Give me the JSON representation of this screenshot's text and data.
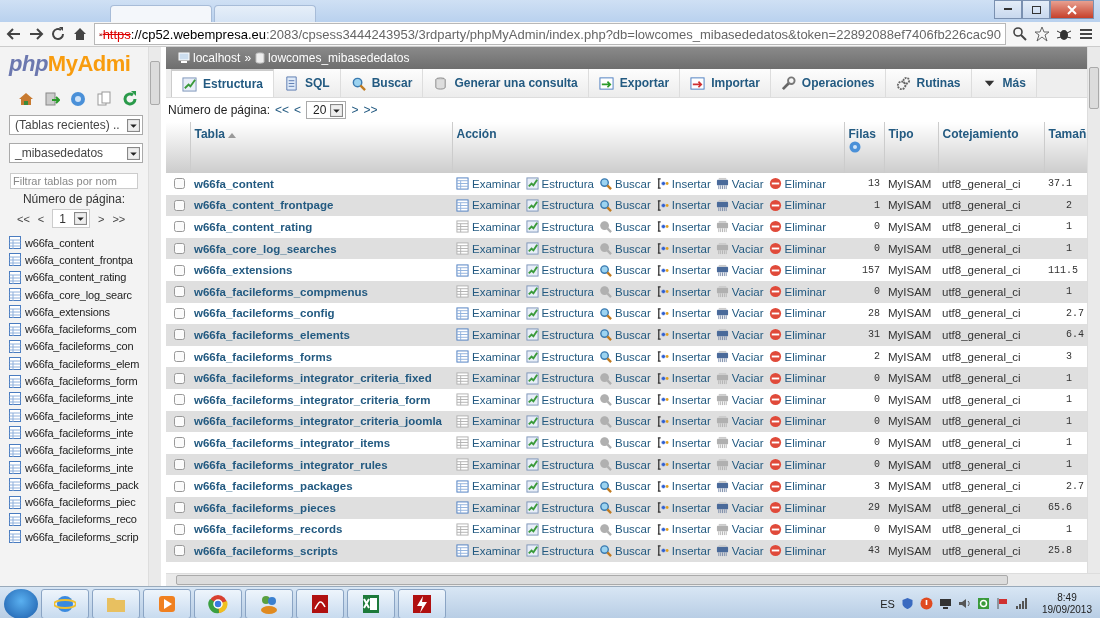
{
  "browser": {
    "url": {
      "scheme": "https",
      "host": "://cp52.webempresa.eu",
      "path": ":2083/cpsess3444243953/3rdparty/phpMyAdmin/index.php?db=lowcomes_mibasededatos&token=22892088ef7406fb226cac90"
    }
  },
  "sidebar": {
    "logo": {
      "php": "php",
      "rest": "MyAdmi"
    },
    "recent_select": "(Tablas recientes) ..",
    "db_select": "_mibasededatos",
    "filter": {
      "placeholder": "Filtrar tablas por nom"
    },
    "page_label": "Número de página:",
    "pager": {
      "first": "<<",
      "prev": "<",
      "page": "1",
      "next": ">",
      "last": ">>"
    },
    "tables": [
      "w66fa_content",
      "w66fa_content_frontpa",
      "w66fa_content_rating",
      "w66fa_core_log_searc",
      "w66fa_extensions",
      "w66fa_facileforms_com",
      "w66fa_facileforms_con",
      "w66fa_facileforms_elem",
      "w66fa_facileforms_form",
      "w66fa_facileforms_inte",
      "w66fa_facileforms_inte",
      "w66fa_facileforms_inte",
      "w66fa_facileforms_inte",
      "w66fa_facileforms_inte",
      "w66fa_facileforms_pack",
      "w66fa_facileforms_piec",
      "w66fa_facileforms_reco",
      "w66fa_facileforms_scrip"
    ]
  },
  "breadcrumb": {
    "server": "localhost",
    "separator": "»",
    "database": "lowcomes_mibasededatos"
  },
  "tabs": [
    {
      "kind": "structure",
      "label": "Estructura",
      "selected": true
    },
    {
      "kind": "sql",
      "label": "SQL",
      "selected": false
    },
    {
      "kind": "search",
      "label": "Buscar",
      "selected": false
    },
    {
      "kind": "query",
      "label": "Generar una consulta",
      "selected": false
    },
    {
      "kind": "export",
      "label": "Exportar",
      "selected": false
    },
    {
      "kind": "import",
      "label": "Importar",
      "selected": false
    },
    {
      "kind": "operations",
      "label": "Operaciones",
      "selected": false
    },
    {
      "kind": "routines",
      "label": "Rutinas",
      "selected": false
    },
    {
      "kind": "more",
      "label": "Más",
      "selected": false
    }
  ],
  "pagination": {
    "label": "Número de página:",
    "first": "<<",
    "prev": "<",
    "value": "20",
    "next": ">",
    "last": ">>"
  },
  "table": {
    "columns": [
      "Tabla",
      "Acción",
      "Filas",
      "Tipo",
      "Cotejamiento",
      "Tamañ"
    ],
    "rows": [
      {
        "name": "w66fa_content",
        "checked": false,
        "empty": false,
        "actions": [
          "Examinar",
          "Estructura",
          "Buscar",
          "Insertar",
          "Vaciar",
          "Eliminar"
        ],
        "rows": "13",
        "type": "MyISAM",
        "collation": "utf8_general_ci",
        "size": "37.1"
      },
      {
        "name": "w66fa_content_frontpage",
        "checked": false,
        "empty": false,
        "actions": [
          "Examinar",
          "Estructura",
          "Buscar",
          "Insertar",
          "Vaciar",
          "Eliminar"
        ],
        "rows": "1",
        "type": "MyISAM",
        "collation": "utf8_general_ci",
        "size": "2"
      },
      {
        "name": "w66fa_content_rating",
        "checked": false,
        "empty": true,
        "actions": [
          "Examinar",
          "Estructura",
          "Buscar",
          "Insertar",
          "Vaciar",
          "Eliminar"
        ],
        "rows": "0",
        "type": "MyISAM",
        "collation": "utf8_general_ci",
        "size": "1"
      },
      {
        "name": "w66fa_core_log_searches",
        "checked": false,
        "empty": true,
        "actions": [
          "Examinar",
          "Estructura",
          "Buscar",
          "Insertar",
          "Vaciar",
          "Eliminar"
        ],
        "rows": "0",
        "type": "MyISAM",
        "collation": "utf8_general_ci",
        "size": "1"
      },
      {
        "name": "w66fa_extensions",
        "checked": false,
        "empty": false,
        "actions": [
          "Examinar",
          "Estructura",
          "Buscar",
          "Insertar",
          "Vaciar",
          "Eliminar"
        ],
        "rows": "157",
        "type": "MyISAM",
        "collation": "utf8_general_ci",
        "size": "111.5"
      },
      {
        "name": "w66fa_facileforms_compmenus",
        "checked": false,
        "empty": true,
        "actions": [
          "Examinar",
          "Estructura",
          "Buscar",
          "Insertar",
          "Vaciar",
          "Eliminar"
        ],
        "rows": "0",
        "type": "MyISAM",
        "collation": "utf8_general_ci",
        "size": "1"
      },
      {
        "name": "w66fa_facileforms_config",
        "checked": false,
        "empty": false,
        "actions": [
          "Examinar",
          "Estructura",
          "Buscar",
          "Insertar",
          "Vaciar",
          "Eliminar"
        ],
        "rows": "28",
        "type": "MyISAM",
        "collation": "utf8_general_ci",
        "size": "2.7"
      },
      {
        "name": "w66fa_facileforms_elements",
        "checked": false,
        "empty": false,
        "actions": [
          "Examinar",
          "Estructura",
          "Buscar",
          "Insertar",
          "Vaciar",
          "Eliminar"
        ],
        "rows": "31",
        "type": "MyISAM",
        "collation": "utf8_general_ci",
        "size": "6.4"
      },
      {
        "name": "w66fa_facileforms_forms",
        "checked": false,
        "empty": false,
        "actions": [
          "Examinar",
          "Estructura",
          "Buscar",
          "Insertar",
          "Vaciar",
          "Eliminar"
        ],
        "rows": "2",
        "type": "MyISAM",
        "collation": "utf8_general_ci",
        "size": "3"
      },
      {
        "name": "w66fa_facileforms_integrator_criteria_fixed",
        "checked": false,
        "empty": true,
        "actions": [
          "Examinar",
          "Estructura",
          "Buscar",
          "Insertar",
          "Vaciar",
          "Eliminar"
        ],
        "rows": "0",
        "type": "MyISAM",
        "collation": "utf8_general_ci",
        "size": "1"
      },
      {
        "name": "w66fa_facileforms_integrator_criteria_form",
        "checked": false,
        "empty": true,
        "actions": [
          "Examinar",
          "Estructura",
          "Buscar",
          "Insertar",
          "Vaciar",
          "Eliminar"
        ],
        "rows": "0",
        "type": "MyISAM",
        "collation": "utf8_general_ci",
        "size": "1"
      },
      {
        "name": "w66fa_facileforms_integrator_criteria_joomla",
        "checked": false,
        "empty": true,
        "actions": [
          "Examinar",
          "Estructura",
          "Buscar",
          "Insertar",
          "Vaciar",
          "Eliminar"
        ],
        "rows": "0",
        "type": "MyISAM",
        "collation": "utf8_general_ci",
        "size": "1"
      },
      {
        "name": "w66fa_facileforms_integrator_items",
        "checked": false,
        "empty": true,
        "actions": [
          "Examinar",
          "Estructura",
          "Buscar",
          "Insertar",
          "Vaciar",
          "Eliminar"
        ],
        "rows": "0",
        "type": "MyISAM",
        "collation": "utf8_general_ci",
        "size": "1"
      },
      {
        "name": "w66fa_facileforms_integrator_rules",
        "checked": false,
        "empty": true,
        "actions": [
          "Examinar",
          "Estructura",
          "Buscar",
          "Insertar",
          "Vaciar",
          "Eliminar"
        ],
        "rows": "0",
        "type": "MyISAM",
        "collation": "utf8_general_ci",
        "size": "1"
      },
      {
        "name": "w66fa_facileforms_packages",
        "checked": false,
        "empty": false,
        "actions": [
          "Examinar",
          "Estructura",
          "Buscar",
          "Insertar",
          "Vaciar",
          "Eliminar"
        ],
        "rows": "3",
        "type": "MyISAM",
        "collation": "utf8_general_ci",
        "size": "2.7"
      },
      {
        "name": "w66fa_facileforms_pieces",
        "checked": false,
        "empty": false,
        "actions": [
          "Examinar",
          "Estructura",
          "Buscar",
          "Insertar",
          "Vaciar",
          "Eliminar"
        ],
        "rows": "29",
        "type": "MyISAM",
        "collation": "utf8_general_ci",
        "size": "65.6"
      },
      {
        "name": "w66fa_facileforms_records",
        "checked": false,
        "empty": true,
        "actions": [
          "Examinar",
          "Estructura",
          "Buscar",
          "Insertar",
          "Vaciar",
          "Eliminar"
        ],
        "rows": "0",
        "type": "MyISAM",
        "collation": "utf8_general_ci",
        "size": "1"
      },
      {
        "name": "w66fa_facileforms_scripts",
        "checked": false,
        "empty": false,
        "actions": [
          "Examinar",
          "Estructura",
          "Buscar",
          "Insertar",
          "Vaciar",
          "Eliminar"
        ],
        "rows": "43",
        "type": "MyISAM",
        "collation": "utf8_general_ci",
        "size": "25.8"
      }
    ]
  },
  "taskbar": {
    "language": "ES",
    "time": "8:49",
    "date": "19/09/2013"
  }
}
